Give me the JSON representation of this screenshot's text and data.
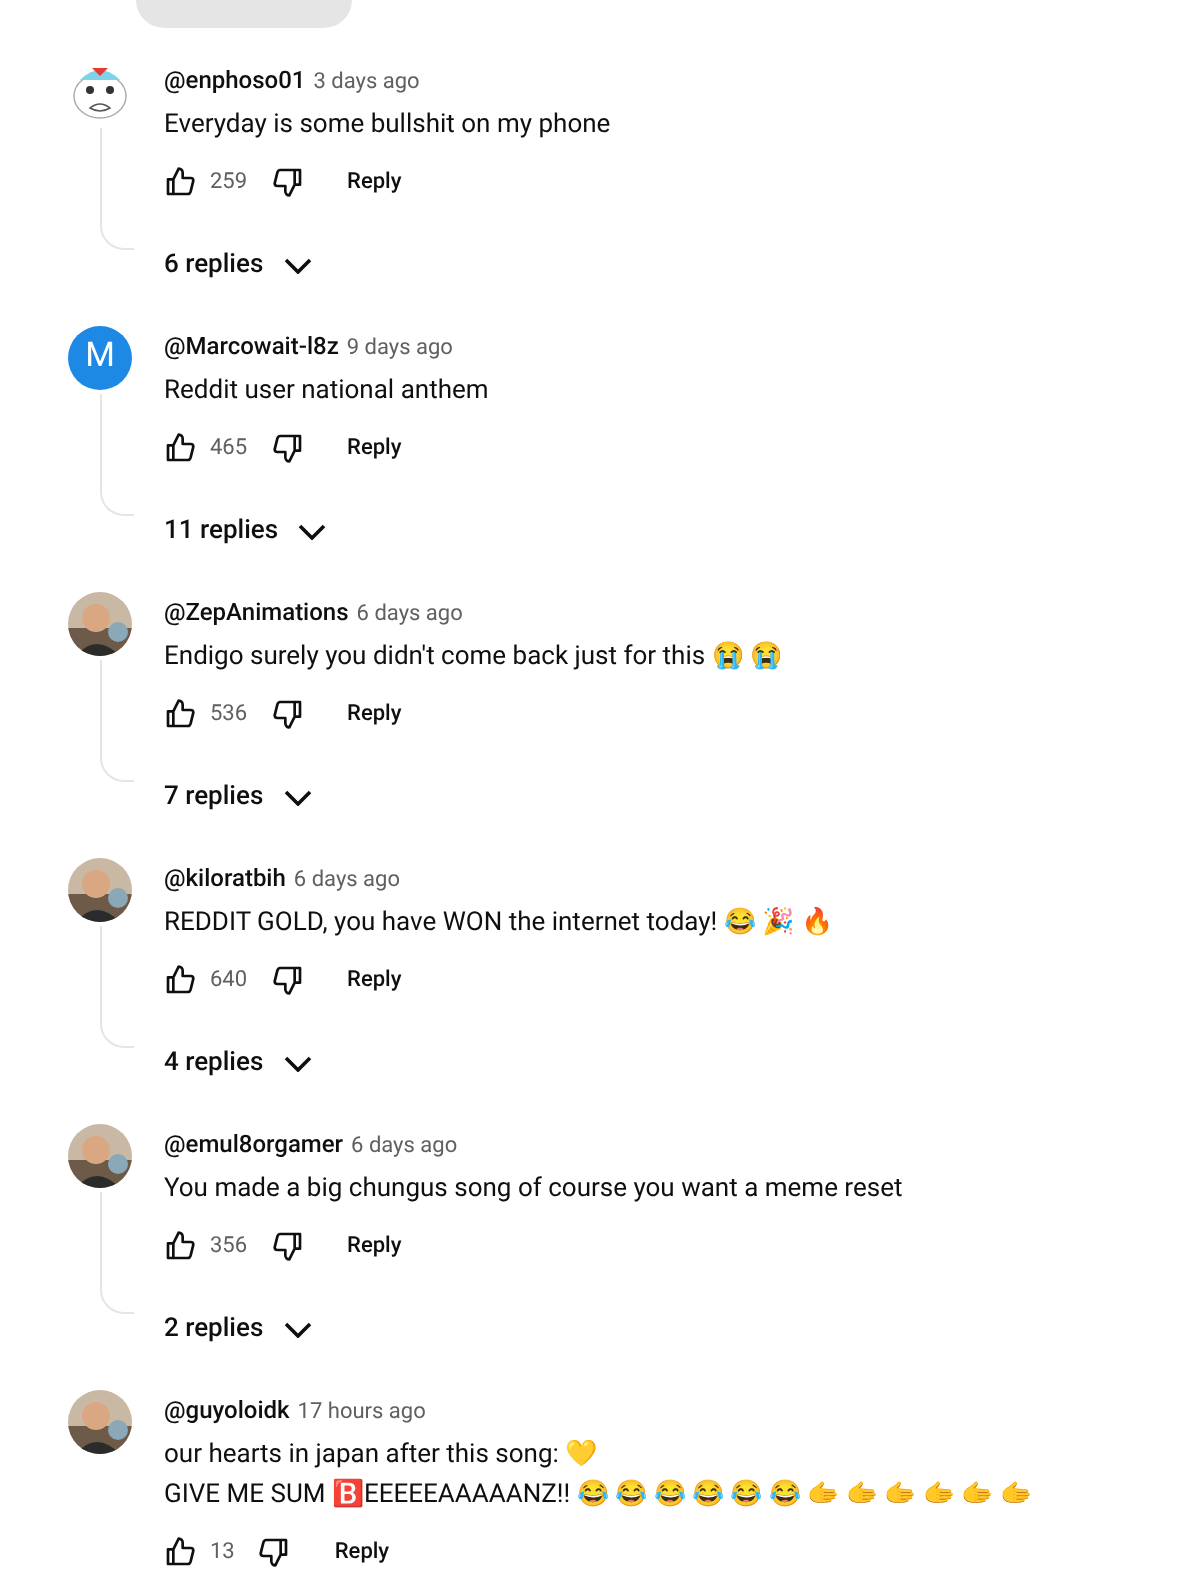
{
  "comments": [
    {
      "avatar": {
        "kind": "drawing"
      },
      "handle": "@enphoso01",
      "time": "3 days ago",
      "lines": [
        "Everyday is some bullshit on my phone"
      ],
      "likes": "259",
      "reply": "Reply",
      "replies": "6 replies"
    },
    {
      "avatar": {
        "kind": "letter",
        "letter": "M",
        "color": "#1e88e5"
      },
      "handle": "@Marcowait-l8z",
      "time": "9 days ago",
      "lines": [
        "Reddit user national anthem"
      ],
      "likes": "465",
      "reply": "Reply",
      "replies": "11 replies"
    },
    {
      "avatar": {
        "kind": "picture"
      },
      "handle": "@ZepAnimations",
      "time": "6 days ago",
      "lines": [
        "Endigo surely you didn't come back just for this 😭 😭"
      ],
      "likes": "536",
      "reply": "Reply",
      "replies": "7 replies"
    },
    {
      "avatar": {
        "kind": "picture"
      },
      "handle": "@kiloratbih",
      "time": "6 days ago",
      "lines": [
        "REDDIT GOLD, you have WON the internet today! 😂 🎉 🔥"
      ],
      "likes": "640",
      "reply": "Reply",
      "replies": "4 replies"
    },
    {
      "avatar": {
        "kind": "picture"
      },
      "handle": "@emul8orgamer",
      "time": "6 days ago",
      "lines": [
        "You made a big chungus song of course you want a meme reset"
      ],
      "likes": "356",
      "reply": "Reply",
      "replies": "2 replies"
    },
    {
      "avatar": {
        "kind": "picture"
      },
      "handle": "@guyoloidk",
      "time": "17 hours ago",
      "lines": [
        "our hearts in japan after this song: 💛",
        "GIVE ME SUM 🅱️EEEEEAAAAANZ!! 😂 😂 😂 😂 😂 😂 🫱 🫱 🫱 🫱 🫱 🫱"
      ],
      "likes": "13",
      "reply": "Reply"
    }
  ]
}
